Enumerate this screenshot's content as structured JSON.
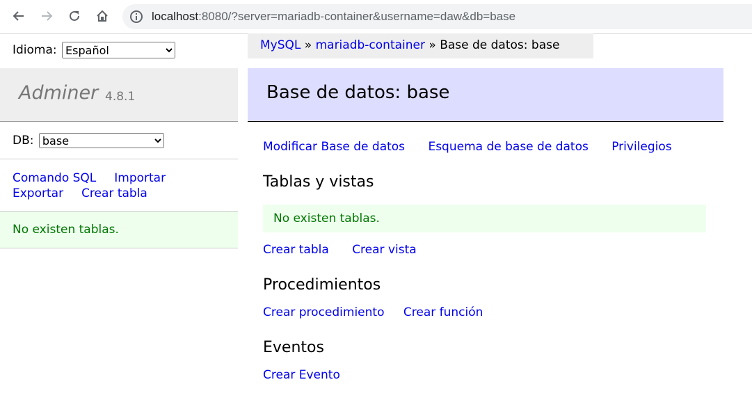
{
  "browser": {
    "url_host": "localhost",
    "url_rest": ":8080/?server=mariadb-container&username=daw&db=base"
  },
  "sidebar": {
    "language_label": "Idioma:",
    "language_selected": "Español",
    "brand_name": "Adminer",
    "brand_version": "4.8.1",
    "db_label": "DB:",
    "db_selected": "base",
    "links": {
      "sql_command": "Comando SQL",
      "import": "Importar",
      "export": "Exportar",
      "create_table": "Crear tabla"
    },
    "no_tables": "No existen tablas."
  },
  "breadcrumb": {
    "mysql": "MySQL",
    "sep": "»",
    "server": "mariadb-container",
    "current": "Base de datos: base"
  },
  "main": {
    "title": "Base de datos: base",
    "top_links": {
      "modify": "Modificar Base de datos",
      "schema": "Esquema de base de datos",
      "privileges": "Privilegios"
    },
    "tables_heading": "Tablas y vistas",
    "no_tables": "No existen tablas.",
    "create_table": "Crear tabla",
    "create_view": "Crear vista",
    "procedures_heading": "Procedimientos",
    "create_procedure": "Crear procedimiento",
    "create_function": "Crear función",
    "events_heading": "Eventos",
    "create_event": "Crear Evento"
  }
}
